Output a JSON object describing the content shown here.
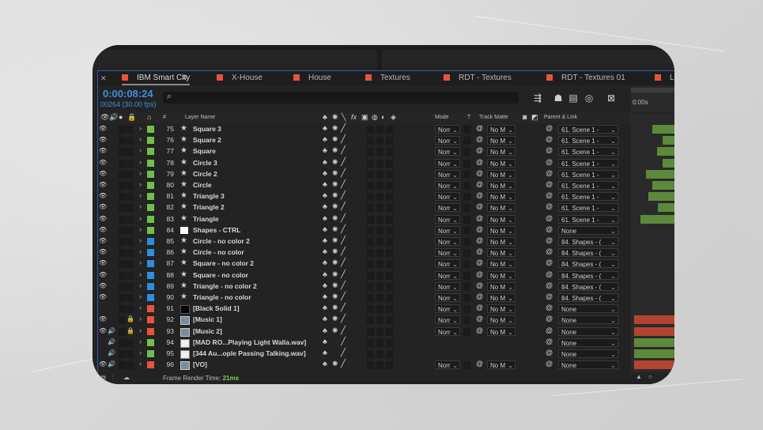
{
  "tabs": [
    {
      "label": "IBM Smart City",
      "active": true
    },
    {
      "label": "X-House"
    },
    {
      "label": "House"
    },
    {
      "label": "Textures"
    },
    {
      "label": "RDT - Textures"
    },
    {
      "label": "RDT - Textures 01"
    },
    {
      "label": "Lig"
    }
  ],
  "timecode": "0:00:08:24",
  "frame_info": "00264 (30.00 fps)",
  "search_placeholder": "",
  "columns": {
    "num": "#",
    "layer_name": "Layer Name",
    "mode": "Mode",
    "t": "T",
    "track_matte": "Track Matte",
    "parent_link": "Parent & Link"
  },
  "timeline": {
    "start": "0:00s",
    "end": "0"
  },
  "colors": {
    "green": "#6fc04b",
    "blue": "#2e8de0",
    "white": "#ffffff",
    "orange": "#e8543a",
    "black": "#000000",
    "tl_green": "#5c8a3c",
    "tl_red": "#b24530",
    "accent": "#3f8fe3"
  },
  "layers": [
    {
      "num": "75",
      "name": "Square 3",
      "label": "green",
      "type": "shape",
      "vis": true,
      "mode": "Norr",
      "matte": "No M",
      "parent": "61. Scene 1 -"
    },
    {
      "num": "76",
      "name": "Square 2",
      "label": "green",
      "type": "shape",
      "vis": true,
      "mode": "Norr",
      "matte": "No M",
      "parent": "61. Scene 1 -"
    },
    {
      "num": "77",
      "name": "Square",
      "label": "green",
      "type": "shape",
      "vis": true,
      "mode": "Norr",
      "matte": "No M",
      "parent": "61. Scene 1 -"
    },
    {
      "num": "78",
      "name": "Circle 3",
      "label": "green",
      "type": "shape",
      "vis": true,
      "mode": "Norr",
      "matte": "No M",
      "parent": "61. Scene 1 -"
    },
    {
      "num": "79",
      "name": "Circle 2",
      "label": "green",
      "type": "shape",
      "vis": true,
      "mode": "Norr",
      "matte": "No M",
      "parent": "61. Scene 1 -"
    },
    {
      "num": "80",
      "name": "Circle",
      "label": "green",
      "type": "shape",
      "vis": true,
      "mode": "Norr",
      "matte": "No M",
      "parent": "61. Scene 1 -"
    },
    {
      "num": "81",
      "name": "Triangle 3",
      "label": "green",
      "type": "shape",
      "vis": true,
      "mode": "Norr",
      "matte": "No M",
      "parent": "61. Scene 1 -"
    },
    {
      "num": "82",
      "name": "Triangle 2",
      "label": "green",
      "type": "shape",
      "vis": true,
      "mode": "Norr",
      "matte": "No M",
      "parent": "61. Scene 1 -"
    },
    {
      "num": "83",
      "name": "Triangle",
      "label": "green",
      "type": "shape",
      "vis": true,
      "mode": "Norr",
      "matte": "No M",
      "parent": "61. Scene 1 -"
    },
    {
      "num": "84",
      "name": "Shapes - CTRL",
      "label": "green",
      "type": "null",
      "vis": true,
      "mode": "Norr",
      "matte": "No M",
      "parent": "None"
    },
    {
      "num": "85",
      "name": "Circle - no color 2",
      "label": "blue",
      "type": "shape",
      "vis": true,
      "mode": "Norr",
      "matte": "No M",
      "parent": "84. Shapes - ("
    },
    {
      "num": "86",
      "name": "Circle - no color",
      "label": "blue",
      "type": "shape",
      "vis": true,
      "mode": "Norr",
      "matte": "No M",
      "parent": "84. Shapes - ("
    },
    {
      "num": "87",
      "name": "Square - no color 2",
      "label": "blue",
      "type": "shape",
      "vis": true,
      "mode": "Norr",
      "matte": "No M",
      "parent": "84. Shapes - ("
    },
    {
      "num": "88",
      "name": "Square - no color",
      "label": "blue",
      "type": "shape",
      "vis": true,
      "mode": "Norr",
      "matte": "No M",
      "parent": "84. Shapes - ("
    },
    {
      "num": "89",
      "name": "Triangle - no color 2",
      "label": "blue",
      "type": "shape",
      "vis": true,
      "mode": "Norr",
      "matte": "No M",
      "parent": "84. Shapes - ("
    },
    {
      "num": "90",
      "name": "Triangle - no color",
      "label": "blue",
      "type": "shape",
      "vis": true,
      "mode": "Norr",
      "matte": "No M",
      "parent": "84. Shapes - ("
    },
    {
      "num": "91",
      "name": "[Black Solid 1]",
      "label": "orange",
      "type": "solid",
      "vis": false,
      "mode": "Norr",
      "matte": "No M",
      "parent": "None"
    },
    {
      "num": "92",
      "name": "[Music 1]",
      "label": "orange",
      "type": "comp",
      "vis": true,
      "lock": true,
      "mode": "Norr",
      "matte": "No M",
      "parent": "None"
    },
    {
      "num": "93",
      "name": "[Music 2]",
      "label": "orange",
      "type": "comp",
      "vis": true,
      "audio": true,
      "lock": true,
      "mode": "Norr",
      "matte": "No M",
      "parent": "None"
    },
    {
      "num": "94",
      "name": "[MAD RO...Playing Light Walla.wav]",
      "label": "green",
      "type": "audio",
      "vis": false,
      "audio": true,
      "mode": "",
      "matte": "",
      "parent": "None"
    },
    {
      "num": "95",
      "name": "[344 Au...ople Passing Talking.wav]",
      "label": "green",
      "type": "audio",
      "vis": false,
      "audio": true,
      "mode": "",
      "matte": "",
      "parent": "None"
    },
    {
      "num": "96",
      "name": "[VO]",
      "label": "orange",
      "type": "comp",
      "vis": true,
      "audio": true,
      "mode": "Norr",
      "matte": "No M",
      "parent": "None"
    }
  ],
  "timeline_bars": [
    {
      "start": 0.45,
      "color": "tl_green"
    },
    {
      "start": 0.72,
      "color": "tl_green"
    },
    {
      "start": 0.58,
      "color": "tl_green"
    },
    {
      "start": 0.72,
      "color": "tl_green"
    },
    {
      "start": 0.3,
      "color": "tl_green"
    },
    {
      "start": 0.45,
      "color": "tl_green"
    },
    {
      "start": 0.35,
      "color": "tl_green"
    },
    {
      "start": 0.6,
      "color": "tl_green"
    },
    {
      "start": 0.15,
      "color": "tl_green"
    },
    null,
    null,
    null,
    null,
    null,
    null,
    null,
    null,
    {
      "start": 0.0,
      "color": "tl_red"
    },
    {
      "start": 0.0,
      "color": "tl_red"
    },
    {
      "start": 0.0,
      "color": "tl_green"
    },
    {
      "start": 0.0,
      "color": "tl_green"
    },
    {
      "start": 0.0,
      "color": "tl_red"
    }
  ],
  "footer": {
    "label": "Frame Render Time:",
    "value": "21ms"
  }
}
